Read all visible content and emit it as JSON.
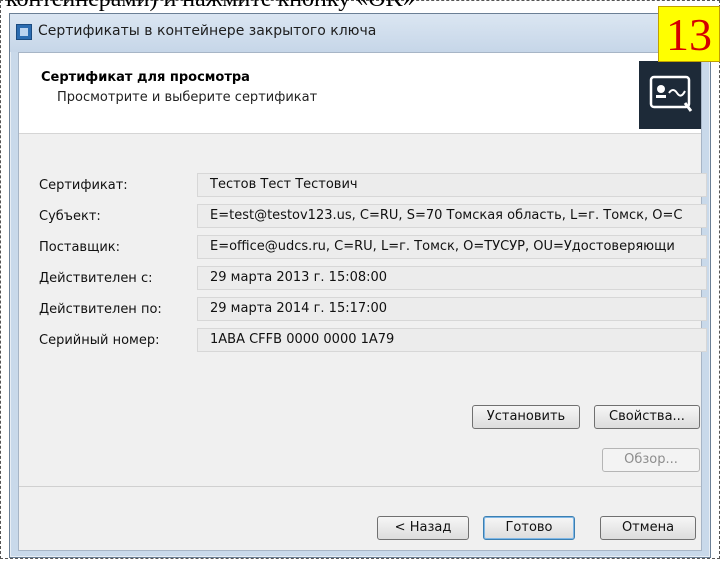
{
  "document": {
    "text_above": "контейнерами) и нажмите кнопку «OK»",
    "step_badge": "13"
  },
  "window": {
    "title": "Сертификаты в контейнере закрытого ключа"
  },
  "header": {
    "title": "Сертификат для просмотра",
    "subtitle": "Просмотрите и выберите сертификат"
  },
  "fields": [
    {
      "label": "Сертификат:",
      "value": "Тестов Тест Тестович"
    },
    {
      "label": "Субъект:",
      "value": "E=test@testov123.us, C=RU, S=70 Томская область, L=г. Томск, O=С"
    },
    {
      "label": "Поставщик:",
      "value": "E=office@udcs.ru, C=RU, L=г. Томск, O=ТУСУР, OU=Удостоверяющи"
    },
    {
      "label": "Действителен с:",
      "value": "29 марта 2013 г. 15:08:00"
    },
    {
      "label": "Действителен по:",
      "value": "29 марта 2014 г. 15:17:00"
    },
    {
      "label": "Серийный номер:",
      "value": "1ABA CFFB 0000 0000 1A79"
    }
  ],
  "buttons": {
    "install": "Установить",
    "properties": "Свойства...",
    "browse": "Обзор...",
    "back": "< Назад",
    "finish": "Готово",
    "cancel": "Отмена"
  },
  "colors": {
    "badge_bg": "#ffff00",
    "badge_text": "#d40000",
    "titlebar": "#c9d9ea",
    "field_bg": "#ececec"
  }
}
